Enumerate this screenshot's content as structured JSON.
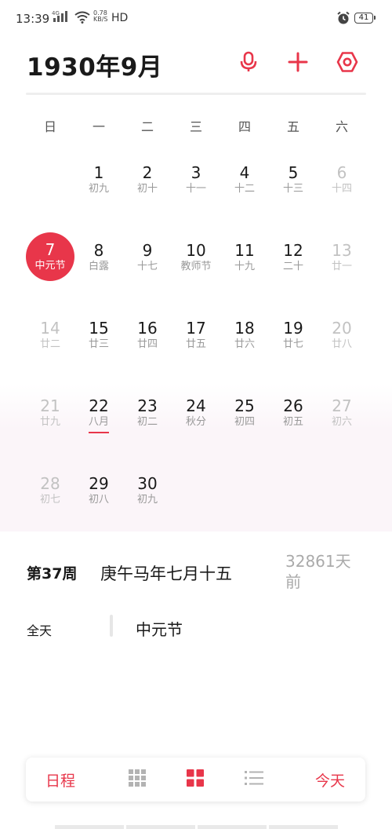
{
  "status": {
    "time": "13:39",
    "network": "4G",
    "speed_value": "0.78",
    "speed_unit": "KB/S",
    "hd": "HD",
    "battery": "41"
  },
  "header": {
    "title": "1930年9月"
  },
  "weekdays": [
    "日",
    "一",
    "二",
    "三",
    "四",
    "五",
    "六"
  ],
  "calendar": {
    "weeks": [
      [
        {
          "d": "",
          "s": ""
        },
        {
          "d": "1",
          "s": "初九"
        },
        {
          "d": "2",
          "s": "初十"
        },
        {
          "d": "3",
          "s": "十一"
        },
        {
          "d": "4",
          "s": "十二"
        },
        {
          "d": "5",
          "s": "十三"
        },
        {
          "d": "6",
          "s": "十四"
        }
      ],
      [
        {
          "d": "7",
          "s": "中元节"
        },
        {
          "d": "8",
          "s": "白露"
        },
        {
          "d": "9",
          "s": "十七"
        },
        {
          "d": "10",
          "s": "教师节"
        },
        {
          "d": "11",
          "s": "十九"
        },
        {
          "d": "12",
          "s": "二十"
        },
        {
          "d": "13",
          "s": "廿一"
        }
      ],
      [
        {
          "d": "14",
          "s": "廿二"
        },
        {
          "d": "15",
          "s": "廿三"
        },
        {
          "d": "16",
          "s": "廿四"
        },
        {
          "d": "17",
          "s": "廿五"
        },
        {
          "d": "18",
          "s": "廿六"
        },
        {
          "d": "19",
          "s": "廿七"
        },
        {
          "d": "20",
          "s": "廿八"
        }
      ],
      [
        {
          "d": "21",
          "s": "廿九"
        },
        {
          "d": "22",
          "s": "八月"
        },
        {
          "d": "23",
          "s": "初二"
        },
        {
          "d": "24",
          "s": "秋分"
        },
        {
          "d": "25",
          "s": "初四"
        },
        {
          "d": "26",
          "s": "初五"
        },
        {
          "d": "27",
          "s": "初六"
        }
      ],
      [
        {
          "d": "28",
          "s": "初七"
        },
        {
          "d": "29",
          "s": "初八"
        },
        {
          "d": "30",
          "s": "初九"
        },
        {
          "d": "",
          "s": ""
        },
        {
          "d": "",
          "s": ""
        },
        {
          "d": "",
          "s": ""
        },
        {
          "d": "",
          "s": ""
        }
      ]
    ]
  },
  "info": {
    "week_no": "第37周",
    "lunar": "庚午马年七月十五",
    "ago": "32861天前"
  },
  "event": {
    "allday": "全天",
    "name": "中元节"
  },
  "tabbar": {
    "schedule": "日程",
    "today": "今天"
  },
  "colors": {
    "accent": "#e8364a",
    "muted_text": "#c2c2c2",
    "sub_text": "#999999"
  },
  "icons": {
    "header": [
      "microphone-icon",
      "plus-icon",
      "settings-icon"
    ],
    "tabbar": [
      "nine-grid-view-icon",
      "four-grid-view-icon",
      "list-view-icon"
    ]
  }
}
